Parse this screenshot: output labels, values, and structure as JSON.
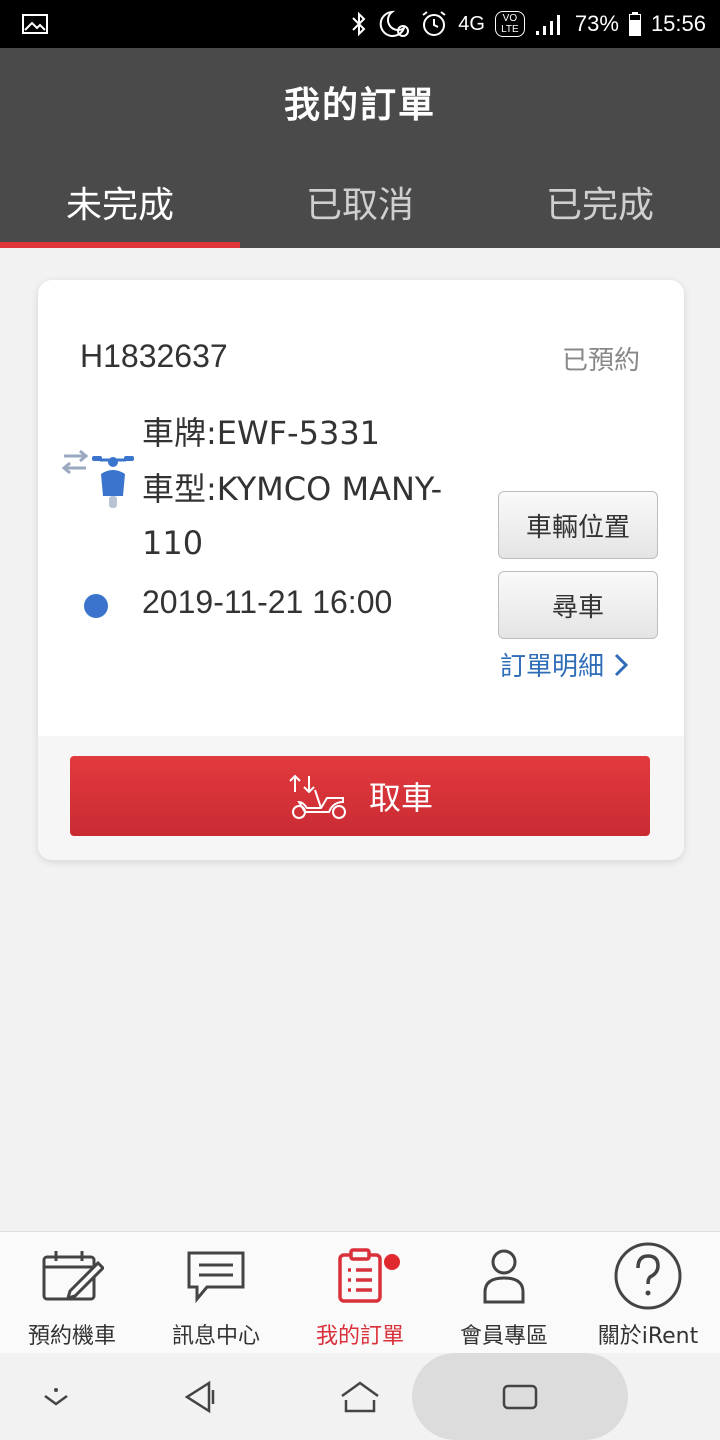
{
  "status_bar": {
    "network": "4G",
    "volte": "VO LTE",
    "battery": "73%",
    "time": "15:56"
  },
  "header": {
    "title": "我的訂單",
    "tabs": [
      {
        "label": "未完成",
        "active": true
      },
      {
        "label": "已取消",
        "active": false
      },
      {
        "label": "已完成",
        "active": false
      }
    ]
  },
  "order": {
    "id": "H1832637",
    "status": "已預約",
    "plate": "車牌:EWF-5331",
    "model": "車型:KYMCO MANY-110",
    "datetime": "2019-11-21 16:00",
    "location_button": "車輛位置",
    "find_button": "尋車",
    "detail_link": "訂單明細",
    "pickup_button": "取車"
  },
  "bottom_nav": {
    "items": [
      {
        "label": "預約機車",
        "icon": "calendar-edit-icon"
      },
      {
        "label": "訊息中心",
        "icon": "chat-bubble-icon"
      },
      {
        "label": "我的訂單",
        "icon": "clipboard-icon",
        "active": true,
        "badge": true
      },
      {
        "label": "會員專區",
        "icon": "user-icon"
      },
      {
        "label": "關於iRent",
        "icon": "question-icon"
      }
    ]
  },
  "colors": {
    "accent_red": "#e0363a",
    "header_bg": "#4a4a4a",
    "link_blue": "#2f6db8",
    "dot_blue": "#3b74cc"
  }
}
